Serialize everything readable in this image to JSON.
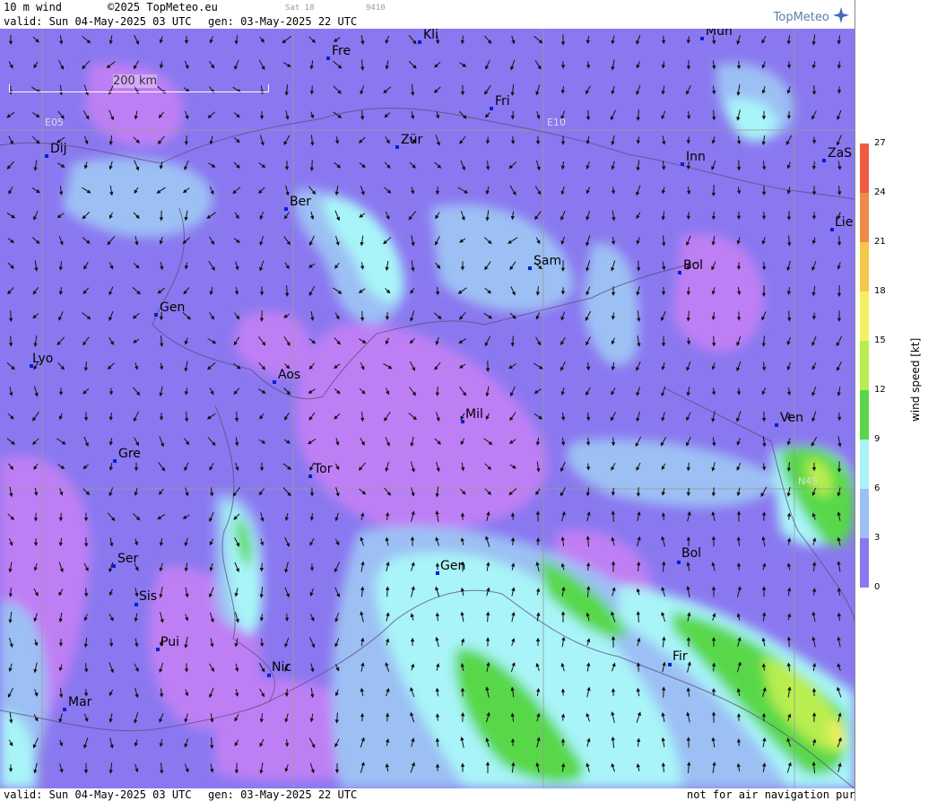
{
  "header": {
    "product": "10 m wind",
    "copyright": "©2025 TopMeteo.eu",
    "valid": "valid:  Sun  04-May-2025  03 UTC",
    "generated": "gen: 03-May-2025 22 UTC",
    "day_code": "Sat 18",
    "run_code": "9410",
    "logo": "TopMeteo"
  },
  "footer": {
    "valid": "valid:  Sun  04-May-2025  03 UTC",
    "generated": "gen: 03-May-2025 22 UTC",
    "disclaimer": "not for air navigation purposes"
  },
  "scale_bar": "200 km",
  "grid_labels": [
    "E05",
    "E10",
    "N45"
  ],
  "cities": [
    "Kli",
    "Mün",
    "Fre",
    "Fri",
    "Dij",
    "Zür",
    "Inn",
    "ZaS",
    "Ber",
    "Lie",
    "Sam",
    "Bol",
    "Gen",
    "Lyo",
    "Aos",
    "Mil",
    "Ven",
    "Gre",
    "Tor",
    "Ser",
    "Gen",
    "Bol",
    "Sis",
    "Pui",
    "Fir",
    "Nic",
    "Mar"
  ],
  "legend": {
    "unit": "wind speed [kt]",
    "ticks": [
      "27",
      "24",
      "21",
      "18",
      "15",
      "12",
      "9",
      "6",
      "3",
      "0"
    ],
    "colors": [
      "#ef5a40",
      "#f08a48",
      "#f6c84a",
      "#f5f060",
      "#b8ee50",
      "#58d848",
      "#a8f4f8",
      "#9cc0f4",
      "#8a78f0",
      "#bf7ff4"
    ]
  }
}
